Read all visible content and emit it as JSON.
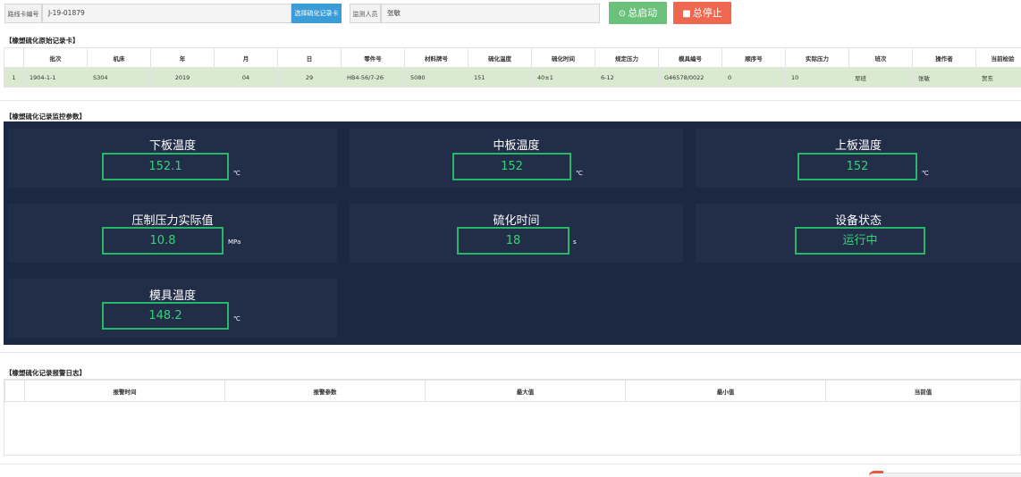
{
  "toolbar": {
    "route_card_label": "路线卡编号",
    "route_card_value": "J-19-01879",
    "select_button": "选择硫化记录卡",
    "inspector_label": "监测人员",
    "inspector_value": "张敏",
    "start_button": "总启动",
    "stop_button": "总停止",
    "start_color": "#6cc17a",
    "stop_color": "#f0674f"
  },
  "record_section_title": "【橡塑硫化原始记录卡】",
  "record_table": {
    "headers": [
      "",
      "批次",
      "机床",
      "年",
      "月",
      "日",
      "零件号",
      "材料牌号",
      "硫化温度",
      "硫化时间",
      "规定压力",
      "模具编号",
      "顺序号",
      "实际压力",
      "班次",
      "操作者",
      "当前检验"
    ],
    "rows": [
      [
        "1",
        "1904-1-1",
        "S304",
        "2019",
        "04",
        "29",
        "HB4-56/7-26",
        "5080",
        "151",
        "40±1",
        "6-12",
        "G46578/0022",
        "0",
        "10",
        "早班",
        "张敏",
        "贺东"
      ]
    ]
  },
  "monitor_section_title": "【橡塑硫化记录监控参数】",
  "monitor": {
    "lower_plate": {
      "title": "下板温度",
      "value": "152.1",
      "unit": "℃"
    },
    "middle_plate": {
      "title": "中板温度",
      "value": "152",
      "unit": "℃"
    },
    "upper_plate": {
      "title": "上板温度",
      "value": "152",
      "unit": "℃"
    },
    "pressure": {
      "title": "压制压力实际值",
      "value": "10.8",
      "unit": "MPa"
    },
    "cure_time": {
      "title": "硫化时间",
      "value": "18",
      "unit": "s"
    },
    "device_status": {
      "title": "设备状态",
      "value": "运行中"
    },
    "mold_temp": {
      "title": "模具温度",
      "value": "148.2",
      "unit": "℃"
    }
  },
  "alarm_section_title": "【橡塑硫化记录报警日志】",
  "alarm_table": {
    "headers": [
      "",
      "报警时间",
      "报警参数",
      "最大值",
      "最小值",
      "当前值"
    ]
  }
}
